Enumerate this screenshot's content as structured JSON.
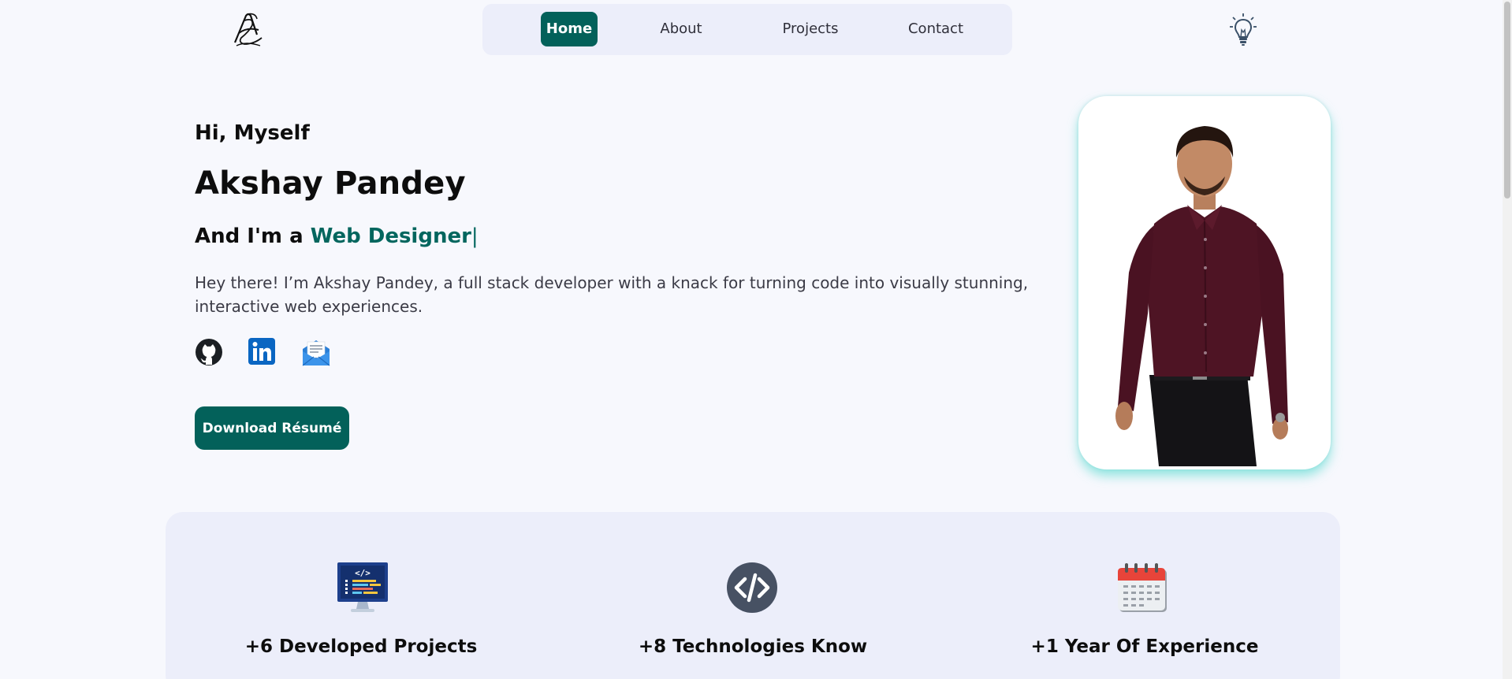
{
  "header": {
    "nav": [
      {
        "label": "Home",
        "active": true
      },
      {
        "label": "About",
        "active": false
      },
      {
        "label": "Projects",
        "active": false
      },
      {
        "label": "Contact",
        "active": false
      }
    ],
    "logo_icon": "signature-logo-icon",
    "theme_toggle_icon": "lightbulb-icon"
  },
  "hero": {
    "greeting": "Hi, Myself",
    "name": "Akshay Pandey",
    "role_prefix": "And I'm a",
    "role_highlight": "Web Designer",
    "role_cursor": "|",
    "bio": "Hey there! I’m Akshay Pandey, a full stack developer with a knack for turning code into visually stunning, interactive web experiences.",
    "socials": [
      "github-icon",
      "linkedin-icon",
      "email-icon"
    ],
    "download_label": "Download Résumé",
    "photo_icon": "profile-photo"
  },
  "stats": [
    {
      "icon": "monitor-code-icon",
      "label": "+6 Developed Projects"
    },
    {
      "icon": "code-brackets-icon",
      "label": "+8 Technologies Know"
    },
    {
      "icon": "calendar-icon",
      "label": "+1 Year Of Experience"
    }
  ],
  "colors": {
    "accent": "#03615a",
    "background": "#f7f8fd",
    "panel": "#eceefa",
    "photo_glow": "#6ededa"
  }
}
